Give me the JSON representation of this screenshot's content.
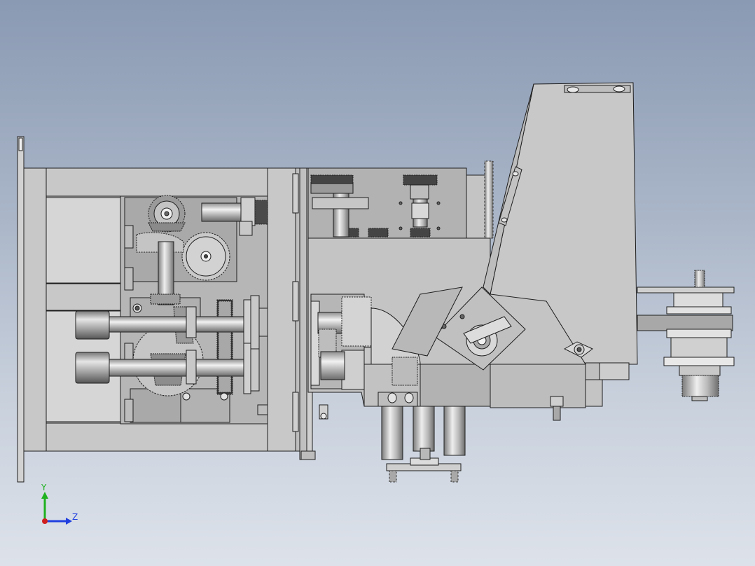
{
  "triad": {
    "y_label": "Y",
    "z_label": "Z",
    "y_color": "#1fb21f",
    "z_color": "#1f3fe0",
    "x_color": "#d01f1f"
  },
  "colors": {
    "background_top": "#8a9ab3",
    "background_bottom": "#dde2ea",
    "part_fill": "#c8c8c8",
    "part_dark": "#9a9a9a",
    "edge": "#1e1e1e"
  }
}
